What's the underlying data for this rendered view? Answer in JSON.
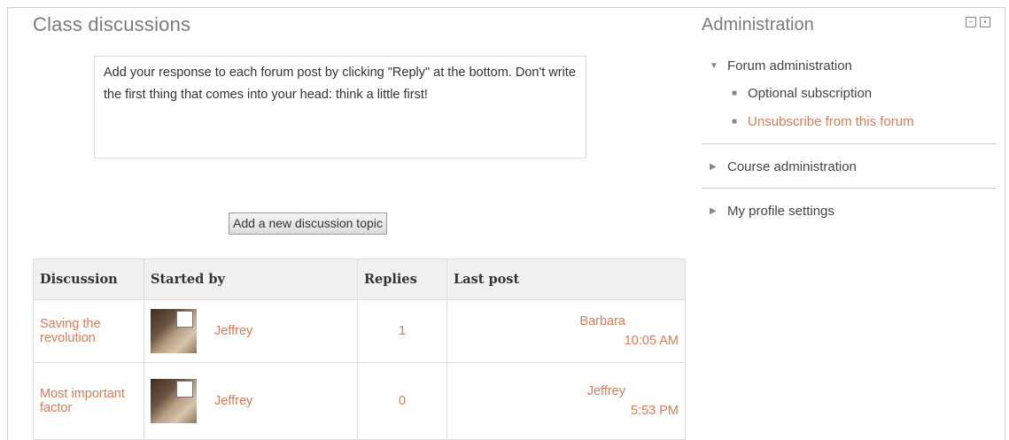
{
  "main": {
    "title": "Class discussions",
    "intro_text": "Add your response to each forum post by clicking \"Reply\" at the bottom. Don't write the first thing that comes into your head: think a little first!",
    "add_topic_button": "Add a new discussion topic",
    "table": {
      "headers": [
        "Discussion",
        "Started by",
        "Replies",
        "Last post"
      ],
      "rows": [
        {
          "discussion": "Saving the revolution",
          "started_by": "Jeffrey",
          "replies": "1",
          "last_post_author": "Barbara",
          "last_post_time": "10:05 AM"
        },
        {
          "discussion": "Most important factor",
          "started_by": "Jeffrey",
          "replies": "0",
          "last_post_author": "Jeffrey",
          "last_post_time": "5:53 PM"
        }
      ]
    }
  },
  "admin": {
    "title": "Administration",
    "forum_admin": "Forum administration",
    "forum_items": [
      "Optional subscription",
      "Unsubscribe from this forum"
    ],
    "course_admin": "Course administration",
    "profile_settings": "My profile settings",
    "icons": [
      "dock-icon",
      "hide-icon"
    ]
  },
  "colors": {
    "link": "#e07a52",
    "title_gray": "#7b7b7b",
    "header_bg": "#f0f0f0"
  }
}
